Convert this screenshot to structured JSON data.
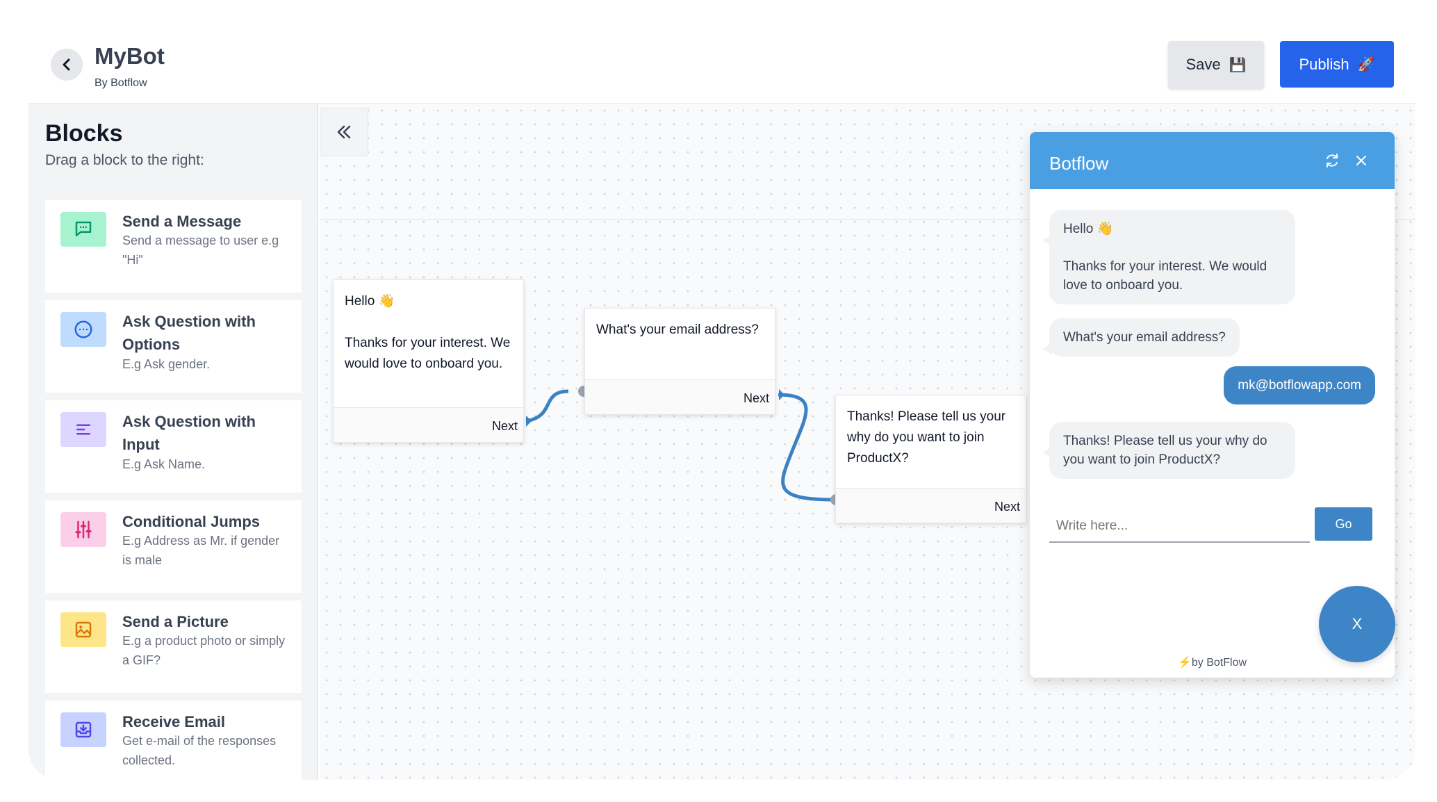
{
  "header": {
    "title": "MyBot",
    "subtitle": "By Botflow",
    "save_label": "Save",
    "save_icon": "💾",
    "publish_label": "Publish",
    "publish_icon": "🚀"
  },
  "sidebar": {
    "title": "Blocks",
    "subtitle": "Drag a block to the right:",
    "blocks": [
      {
        "title": "Send a Message",
        "description": "Send a message to user e.g \"Hi\"",
        "icon": "message-icon",
        "color": "#a7f3d0",
        "icon_color": "#059669"
      },
      {
        "title": "Ask Question with Options",
        "description": "E.g Ask gender.",
        "icon": "options-icon",
        "color": "#bfdbfe",
        "icon_color": "#2563eb"
      },
      {
        "title": "Ask Question with Input",
        "description": "E.g Ask Name.",
        "icon": "input-icon",
        "color": "#ddd6fe",
        "icon_color": "#7c3aed"
      },
      {
        "title": "Conditional Jumps",
        "description": "E.g Address as Mr. if gender is male",
        "icon": "sliders-icon",
        "color": "#fbcfe8",
        "icon_color": "#db2777"
      },
      {
        "title": "Send a Picture",
        "description": "E.g a product photo or simply a GIF?",
        "icon": "picture-icon",
        "color": "#fde68a",
        "icon_color": "#d97706"
      },
      {
        "title": "Receive Email",
        "description": "Get e-mail of the responses collected.",
        "icon": "inbox-icon",
        "color": "#c7d2fe",
        "icon_color": "#4f46e5"
      }
    ]
  },
  "canvas": {
    "nodes": [
      {
        "text": "Hello 👋\n\nThanks for your interest. We would love to onboard you.",
        "next_label": "Next"
      },
      {
        "text": "What's your email address?",
        "next_label": "Next"
      },
      {
        "text": "Thanks! Please tell us your why do you want to join ProductX?",
        "next_label": "Next"
      }
    ],
    "connector_color": "#3b82c4"
  },
  "chat": {
    "title": "Botflow",
    "header_color": "#4a9fe3",
    "messages": [
      {
        "from": "bot",
        "text": "Hello 👋\n\nThanks for your interest. We would love to onboard you."
      },
      {
        "from": "bot",
        "text": "What's your email address?"
      },
      {
        "from": "user",
        "text": "mk@botflowapp.com"
      },
      {
        "from": "bot",
        "text": "Thanks! Please tell us your why do you want to join ProductX?"
      }
    ],
    "input_placeholder": "Write here...",
    "send_label": "Go",
    "footer": "⚡by BotFlow"
  },
  "fab_label": "X"
}
